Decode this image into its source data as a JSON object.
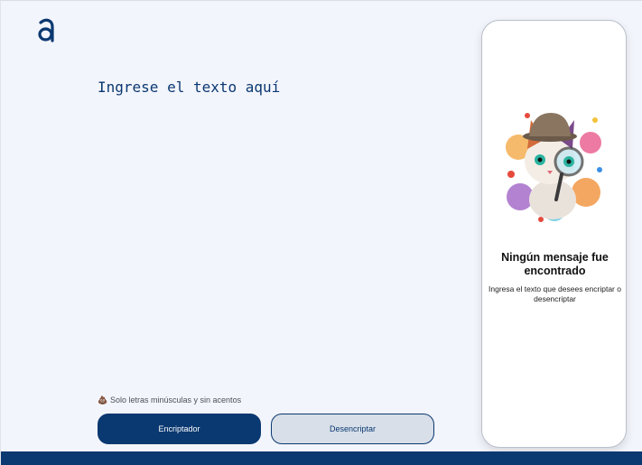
{
  "brand": {
    "logo_icon": "alura-a-logo-icon",
    "accent": "#0a3871"
  },
  "input": {
    "placeholder": "Ingrese el texto aquí",
    "value": ""
  },
  "hint": {
    "icon": "info-icon",
    "text": "Solo letras minúsculas y sin acentos"
  },
  "buttons": {
    "encrypt_label": "Encriptador",
    "decrypt_label": "Desencriptar"
  },
  "result": {
    "image": "cat-detective-magnifier-illustration",
    "title": "Ningún mensaje fue encontrado",
    "subtitle": "Ingresa el texto que desees encriptar o desencriptar"
  },
  "colors": {
    "background": "#f3f5fc",
    "primary": "#0a3871",
    "secondary_button": "#d8dfe8",
    "panel": "#ffffff"
  }
}
